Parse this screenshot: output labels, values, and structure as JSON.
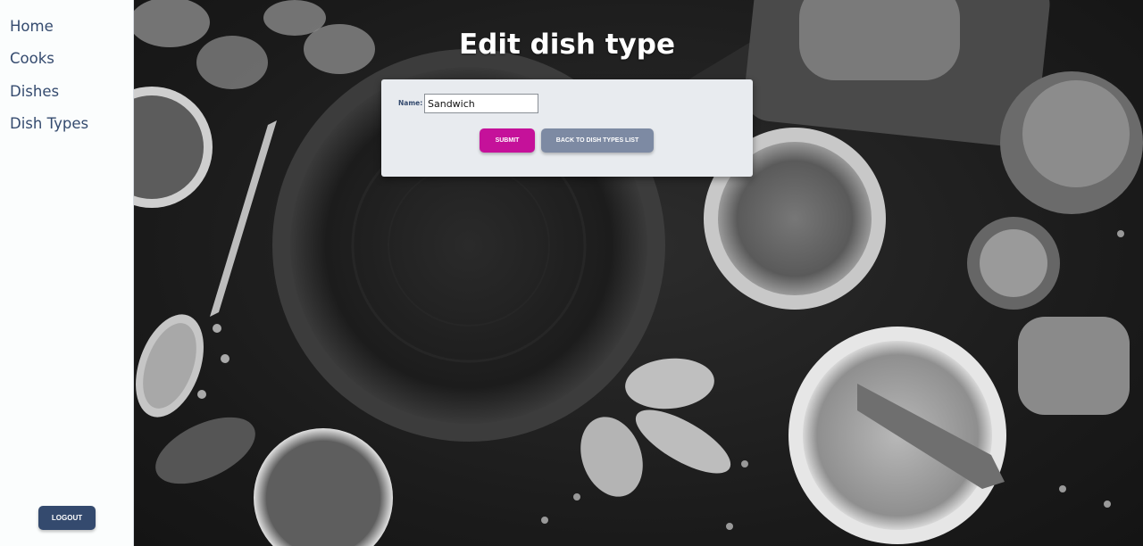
{
  "sidebar": {
    "items": [
      {
        "label": "Home"
      },
      {
        "label": "Cooks"
      },
      {
        "label": "Dishes"
      },
      {
        "label": "Dish Types"
      }
    ],
    "logout_label": "LOGOUT"
  },
  "page": {
    "title": "Edit dish type"
  },
  "form": {
    "name_label": "Name:",
    "name_value": "Sandwich",
    "submit_label": "SUBMIT",
    "back_label": "BACK TO DISH TYPES LIST"
  },
  "colors": {
    "accent": "#c5119a",
    "primary": "#344a6e",
    "secondary": "#7d8aa3"
  }
}
